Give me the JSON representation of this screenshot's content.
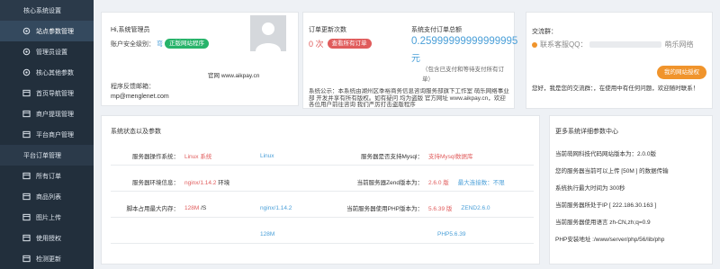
{
  "sidebar": {
    "items": [
      {
        "label": "核心系统设置",
        "icon": "none",
        "type": "top"
      },
      {
        "label": "站点参数管理",
        "icon": "gear-icon",
        "type": "sub-active"
      },
      {
        "label": "管理员设置",
        "icon": "gear-icon",
        "type": "sub"
      },
      {
        "label": "核心其他参数",
        "icon": "gear-icon",
        "type": "sub"
      },
      {
        "label": "首页导航管理",
        "icon": "list-icon",
        "type": "sub"
      },
      {
        "label": "商户提现管理",
        "icon": "list-icon",
        "type": "sub"
      },
      {
        "label": "平台商户管理",
        "icon": "list-icon",
        "type": "sub"
      },
      {
        "label": "平台订单管理",
        "icon": "none",
        "type": "top"
      },
      {
        "label": "所有订单",
        "icon": "list-icon",
        "type": "sub"
      },
      {
        "label": "商品列表",
        "icon": "list-icon",
        "type": "sub"
      },
      {
        "label": "图片上传",
        "icon": "list-icon",
        "type": "sub"
      },
      {
        "label": "使用授权",
        "icon": "list-icon",
        "type": "sub"
      },
      {
        "label": "检测更新",
        "icon": "list-icon",
        "type": "sub"
      }
    ]
  },
  "admin_card": {
    "greeting": "Hi,系统管理员",
    "security_label": "账户安全级别：",
    "security_level": "弯",
    "badge": "正版网站程序",
    "website_label": "官网",
    "website": "www.aikpay.cn",
    "email_label": "程序反馈邮箱：",
    "email": "mp@menglenet.com"
  },
  "orders_card": {
    "today_label": "订单更新次数",
    "today_value": "0 次",
    "view_button": "查看所有订单",
    "total_label": "系统支付订单总额",
    "total_value": "0.25999999999999995",
    "unit": "元",
    "note": "（包含已支付和等待支付所有订单）",
    "company_text": "系统公示：本系统由湖州区季裕商务信息咨询服务部旗下工作室 萌乐网络事业部 开发并享有所有版权。如有疑问 均为盗版 官方网址 www.aikpay.cn，欢迎各位用户前往咨询 我们严厉打击盗版程序"
  },
  "group_card": {
    "title": "交流群：",
    "group_label": "联系客服QQ：",
    "group_value": "（已隐藏）",
    "group_suffix": "萌乐网络",
    "button": "我的网站授权",
    "footer": "您好，我是您的交流群：，在使用中有任何问题，欢迎随时联系！"
  },
  "status_panel": {
    "title": "系统状态以及参数",
    "rows": [
      {
        "l_label": "服务器操作系统：",
        "l_value": "Linux 系统",
        "l_extra": "Linux",
        "r_label": "服务器是否支持Mysql：",
        "r_value": "支持Mysql数据库",
        "r_extra": ""
      },
      {
        "l_label": "服务器环境信息：",
        "l_value": "nginx/1.14.2",
        "l_extra": "环境",
        "r_label": "当前服务器Zend版本为：",
        "r_value": "2.6.0 版",
        "r_extra": "最大连接数：不限"
      },
      {
        "l_label": "脚本占用最大内存：",
        "l_value": "128M",
        "l_extra": "/S",
        "l_extra2": "nginx/1.14.2",
        "r_label": "当前服务器使用PHP版本为：",
        "r_value": "5.6.39 版",
        "r_extra": "ZEND2.6.0"
      },
      {
        "l_label": "",
        "l_value": "",
        "l_extra": "128M",
        "r_label": "",
        "r_value": "",
        "r_extra": "PHP5.6.39"
      }
    ]
  },
  "env_panel": {
    "title": "更多系统详细参数中心",
    "lines": [
      "当前萌网科技代码网站版本为：2.0.0版",
      "您的服务器当前可以上传 [50M ] 的数据传输",
      "系统执行最大时间为 300秒",
      "当前服务器所处于IP [ 222.186.30.163 ]",
      "当前服务器使用语言 zh-CN,zh;q=0.9",
      "PHP安装地址 :/www/server/php/56/lib/php"
    ]
  },
  "colors": {
    "sidebar": "#2b3a4a",
    "green": "#27b36a",
    "red": "#e05c5c",
    "blue": "#4a9fd8",
    "orange": "#f0942c"
  }
}
